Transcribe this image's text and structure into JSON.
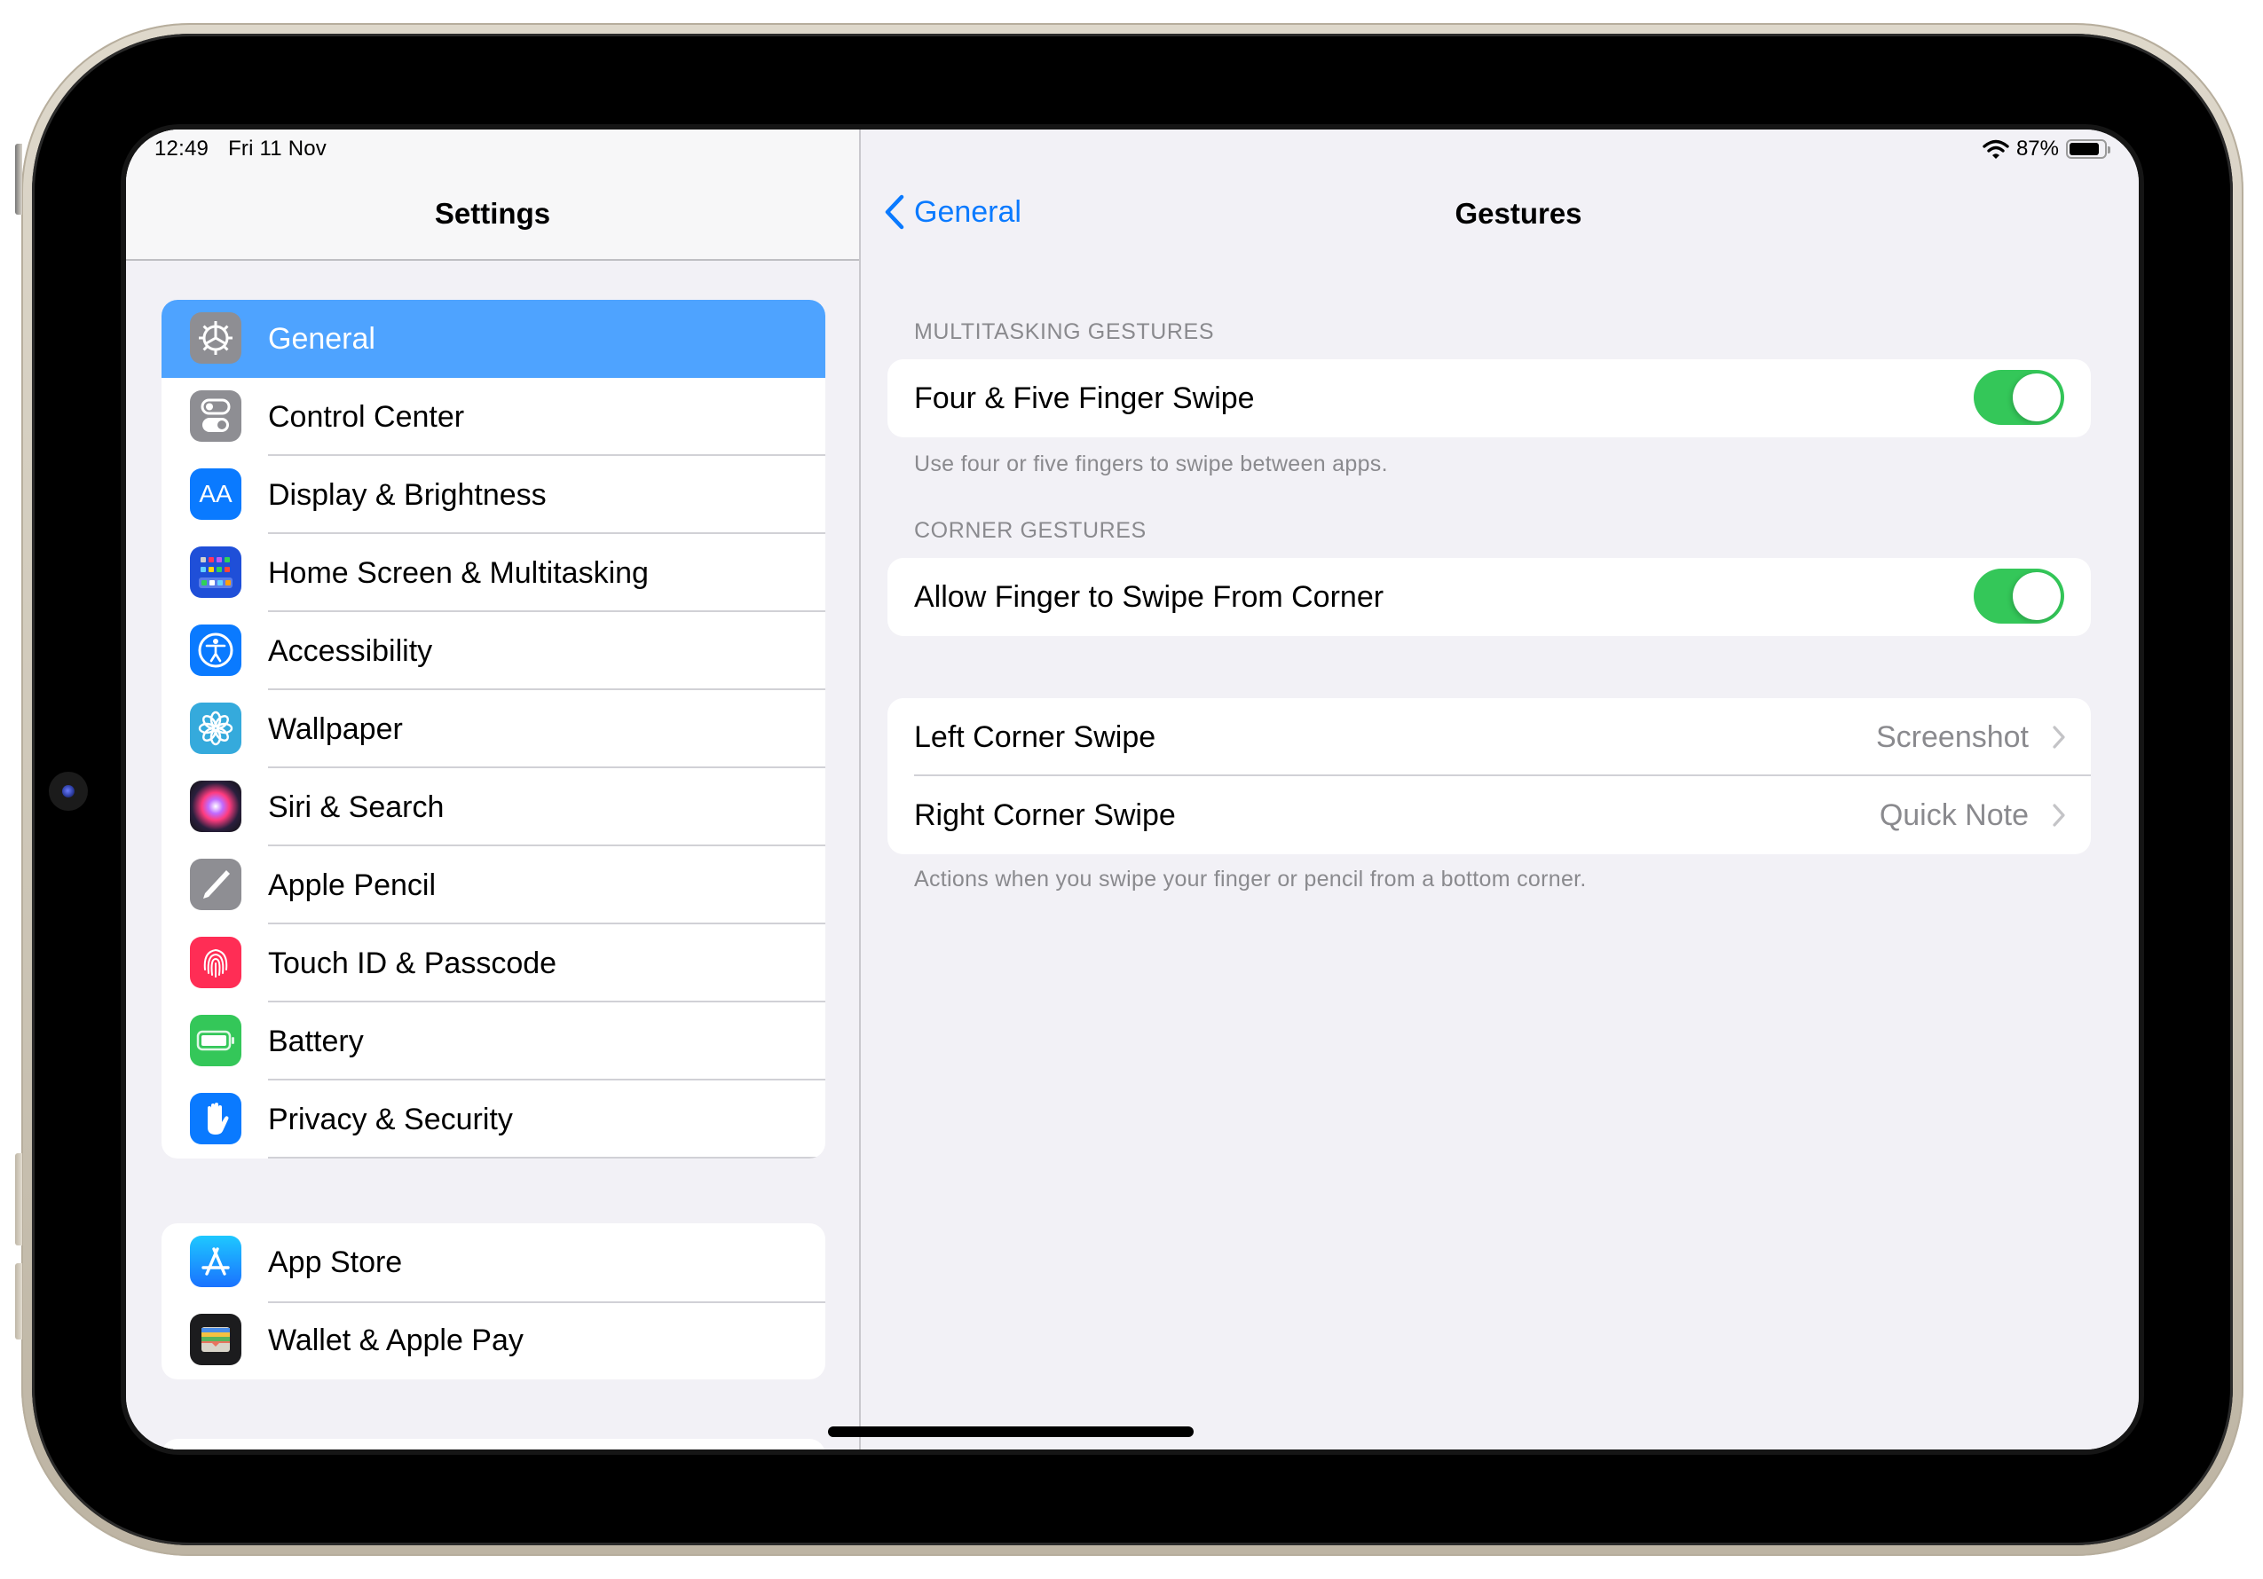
{
  "status_bar": {
    "time": "12:49",
    "date": "Fri 11 Nov",
    "battery_percent_label": "87%",
    "battery_level": 0.87,
    "wifi_icon": "wifi-icon",
    "battery_icon": "battery-icon"
  },
  "sidebar": {
    "title": "Settings",
    "groups": [
      {
        "items": [
          {
            "label": "General",
            "icon": "gear-icon",
            "color": "#8e8e93",
            "selected": true
          },
          {
            "label": "Control Center",
            "icon": "control-center-icon",
            "color": "#8e8e93"
          },
          {
            "label": "Display & Brightness",
            "icon": "display-brightness-icon",
            "color": "#0a7aff"
          },
          {
            "label": "Home Screen & Multitasking",
            "icon": "home-screen-icon",
            "color": "#1f4fd8"
          },
          {
            "label": "Accessibility",
            "icon": "accessibility-icon",
            "color": "#0a7aff"
          },
          {
            "label": "Wallpaper",
            "icon": "wallpaper-icon",
            "color": "#35aadc"
          },
          {
            "label": "Siri & Search",
            "icon": "siri-icon",
            "color": "#1c1c1e"
          },
          {
            "label": "Apple Pencil",
            "icon": "pencil-icon",
            "color": "#8e8e93"
          },
          {
            "label": "Touch ID & Passcode",
            "icon": "fingerprint-icon",
            "color": "#ff2d55"
          },
          {
            "label": "Battery",
            "icon": "battery-icon",
            "color": "#34c759"
          },
          {
            "label": "Privacy & Security",
            "icon": "hand-icon",
            "color": "#0a7aff"
          }
        ]
      },
      {
        "items": [
          {
            "label": "App Store",
            "icon": "app-store-icon",
            "color": "#1a8cff"
          },
          {
            "label": "Wallet & Apple Pay",
            "icon": "wallet-icon",
            "color": "#1c1c1e"
          }
        ]
      }
    ]
  },
  "detail": {
    "back_label": "General",
    "title": "Gestures",
    "sections": [
      {
        "header": "MULTITASKING GESTURES",
        "rows": [
          {
            "label": "Four & Five Finger Swipe",
            "type": "toggle",
            "on": true
          }
        ],
        "footer": "Use four or five fingers to swipe between apps."
      },
      {
        "header": "CORNER GESTURES",
        "rows": [
          {
            "label": "Allow Finger to Swipe From Corner",
            "type": "toggle",
            "on": true
          }
        ],
        "footer": ""
      },
      {
        "header": "",
        "rows": [
          {
            "label": "Left Corner Swipe",
            "type": "disclosure",
            "value": "Screenshot"
          },
          {
            "label": "Right Corner Swipe",
            "type": "disclosure",
            "value": "Quick Note"
          }
        ],
        "footer": "Actions when you swipe your finger or pencil from a bottom corner."
      }
    ]
  },
  "colors": {
    "accent": "#0a7aff",
    "selection": "#4ea3ff",
    "toggle_on": "#34c759",
    "background": "#f2f1f6",
    "secondary_text": "#8a8a8e"
  }
}
